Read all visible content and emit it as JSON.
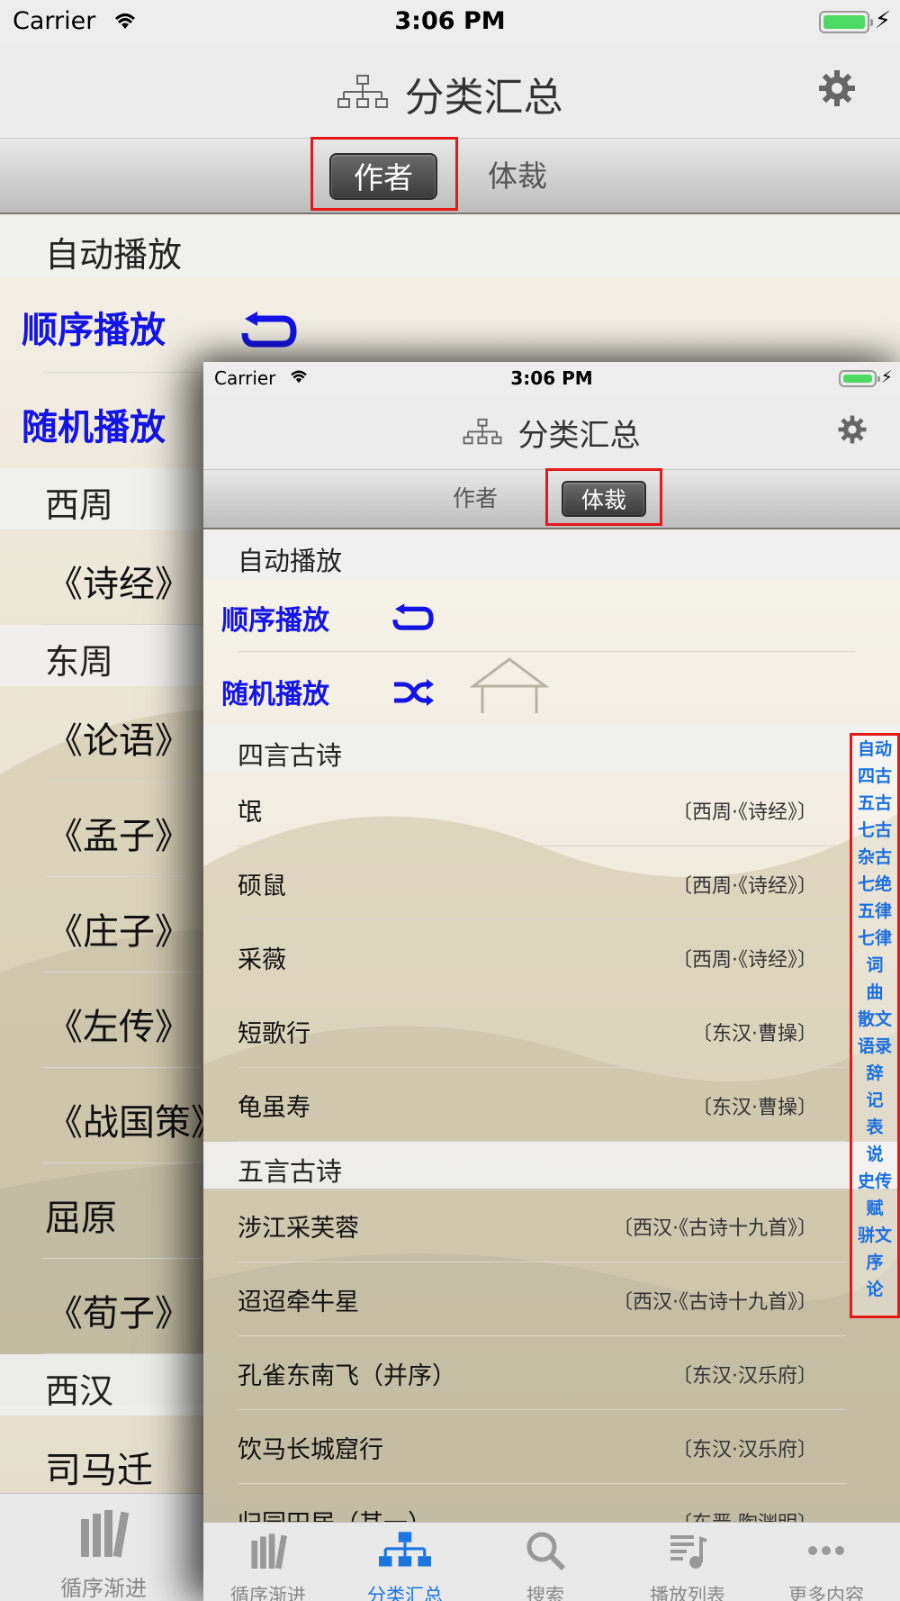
{
  "status": {
    "carrier": "Carrier",
    "time": "3:06 PM"
  },
  "nav": {
    "title": "分类汇总"
  },
  "segments": {
    "author": "作者",
    "genre": "体裁"
  },
  "back": {
    "auto_header": "自动播放",
    "sequential": "顺序播放",
    "random": "随机播放",
    "rows": [
      {
        "kind": "header",
        "text": "西周"
      },
      {
        "kind": "item",
        "text": "《诗经》"
      },
      {
        "kind": "header",
        "text": "东周"
      },
      {
        "kind": "item",
        "text": "《论语》"
      },
      {
        "kind": "item",
        "text": "《孟子》"
      },
      {
        "kind": "item",
        "text": "《庄子》"
      },
      {
        "kind": "item",
        "text": "《左传》"
      },
      {
        "kind": "item",
        "text": "《战国策》"
      },
      {
        "kind": "item",
        "text": "屈原"
      },
      {
        "kind": "item",
        "text": "《荀子》"
      },
      {
        "kind": "header",
        "text": "西汉"
      },
      {
        "kind": "item",
        "text": "司马迁"
      }
    ],
    "tab_label": "循序渐进"
  },
  "front": {
    "auto_header": "自动播放",
    "sequential": "顺序播放",
    "random": "随机播放",
    "sections": [
      {
        "title": "四言古诗",
        "poems": [
          {
            "name": "氓",
            "source": "〔西周·《诗经》〕"
          },
          {
            "name": "硕鼠",
            "source": "〔西周·《诗经》〕"
          },
          {
            "name": "采薇",
            "source": "〔西周·《诗经》〕"
          },
          {
            "name": "短歌行",
            "source": "〔东汉·曹操〕"
          },
          {
            "name": "龟虽寿",
            "source": "〔东汉·曹操〕"
          }
        ]
      },
      {
        "title": "五言古诗",
        "poems": [
          {
            "name": "涉江采芙蓉",
            "source": "〔西汉·《古诗十九首》〕"
          },
          {
            "name": "迢迢牵牛星",
            "source": "〔西汉·《古诗十九首》〕"
          },
          {
            "name": "孔雀东南飞（并序）",
            "source": "〔东汉·汉乐府〕"
          },
          {
            "name": "饮马长城窟行",
            "source": "〔东汉·汉乐府〕"
          },
          {
            "name": "归园田居（其一）",
            "source": "〔东晋·陶渊明〕"
          }
        ]
      }
    ],
    "index": [
      "自动",
      "四古",
      "五古",
      "七古",
      "杂古",
      "七绝",
      "五律",
      "七律",
      "词",
      "曲",
      "散文",
      "语录",
      "辞",
      "记",
      "表",
      "说",
      "史传",
      "赋",
      "骈文",
      "序",
      "论"
    ],
    "tabs": [
      "循序渐进",
      "分类汇总",
      "搜索",
      "播放列表",
      "更多内容"
    ]
  },
  "colors": {
    "accent_blue": "#1414e6",
    "tab_active": "#1a75e0",
    "highlight_red": "#e61818"
  }
}
